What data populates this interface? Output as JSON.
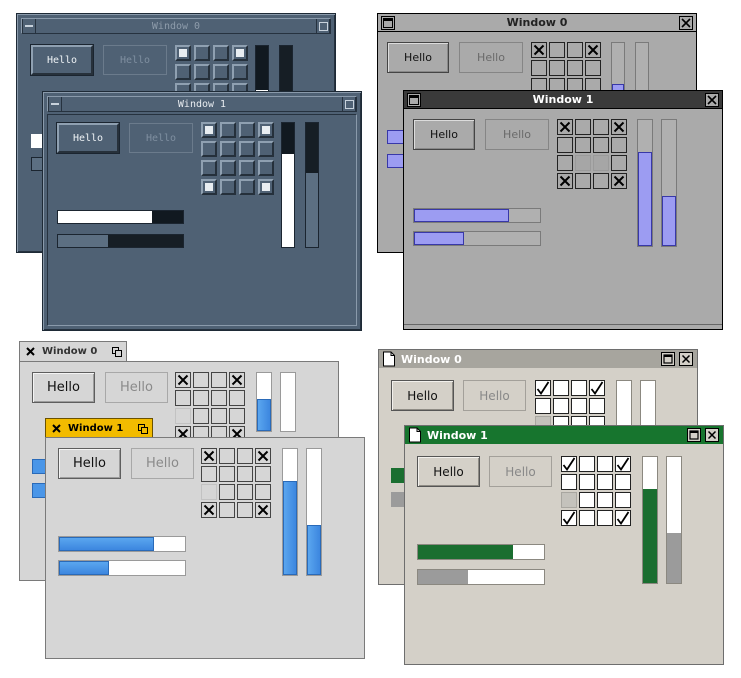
{
  "window0_title": "Window 0",
  "window1_title": "Window 1",
  "button_label": "Hello",
  "disabled_button_label": "Hello",
  "icons": {
    "window_menu": "window-menu-icon",
    "minimize": "minimize-icon",
    "maximize": "maximize-icon",
    "close": "close-icon",
    "document": "document-icon",
    "check": "check-icon",
    "x": "x-mark-icon"
  },
  "themes": [
    {
      "name": "slate",
      "accent": "#4f6174",
      "window0": {
        "hbar1": 0.0,
        "hbar2": 0.0,
        "vbar1": 0.25,
        "vbar2": 0.0
      },
      "window1": {
        "grid_checked": [
          0,
          3,
          12,
          15
        ],
        "hbar1": 0.75,
        "hbar2": 0.4,
        "vbar1": 0.75,
        "vbar2": 0.4
      }
    },
    {
      "name": "gray-lavender",
      "accent": "#9c9cf2",
      "window1": {
        "grid_checked": [
          0,
          3,
          12,
          15
        ],
        "grid_gray": [
          9,
          10
        ],
        "hbar1": 0.75,
        "hbar2": 0.4,
        "vbar1": 0.75,
        "vbar2": 0.4
      }
    },
    {
      "name": "light-blue",
      "accent": "#4a96e8",
      "window1": {
        "grid_checked": [
          0,
          3,
          12,
          15
        ],
        "grid_gray": [
          8
        ],
        "hbar1": 0.75,
        "hbar2": 0.4,
        "vbar1": 0.75,
        "vbar2": 0.4
      }
    },
    {
      "name": "beige-green",
      "accent": "#17752e",
      "window1": {
        "grid_checked": [
          0,
          3,
          12,
          15
        ],
        "grid_gray": [
          8
        ],
        "hbar1": 0.75,
        "hbar2": 0.4,
        "vbar1": 0.75,
        "vbar2": 0.4
      }
    }
  ]
}
